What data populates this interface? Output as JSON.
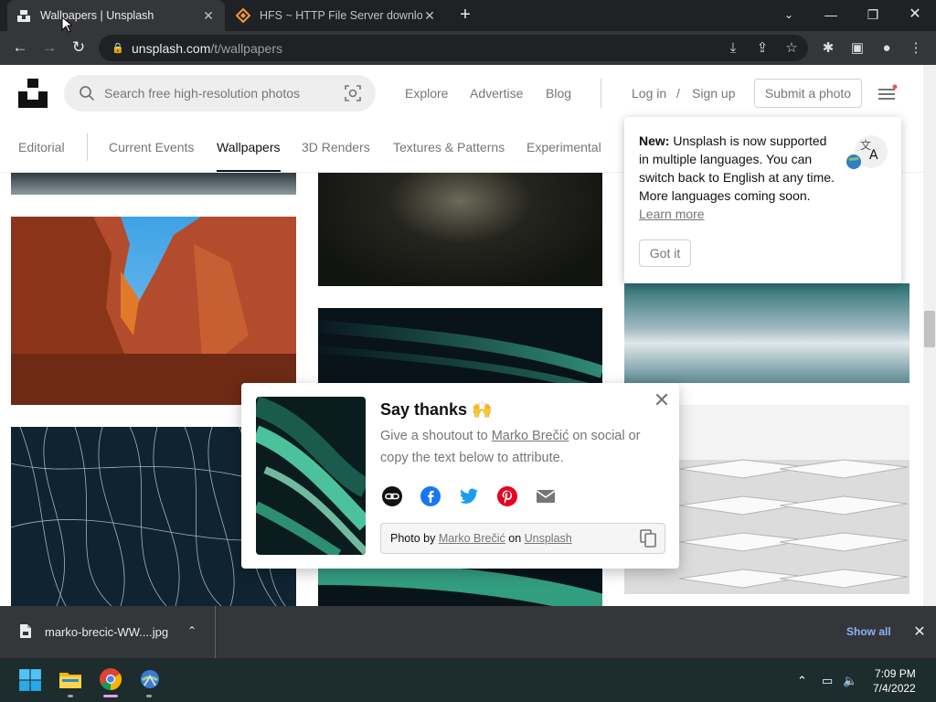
{
  "browser": {
    "tabs": [
      {
        "title": "Wallpapers | Unsplash",
        "active": true
      },
      {
        "title": "HFS ~ HTTP File Server download",
        "active": false
      }
    ],
    "url_host": "unsplash.com",
    "url_path": "/t/wallpapers"
  },
  "header": {
    "search_placeholder": "Search free high-resolution photos",
    "nav": [
      "Explore",
      "Advertise",
      "Blog"
    ],
    "login": "Log in",
    "slash": "/",
    "signup": "Sign up",
    "submit": "Submit a photo"
  },
  "topics": [
    "Editorial",
    "Current Events",
    "Wallpapers",
    "3D Renders",
    "Textures & Patterns",
    "Experimental"
  ],
  "lang_popup": {
    "bold": "New:",
    "text": " Unsplash is now supported in multiple languages. You can switch back to English at any time. More languages coming soon.",
    "link": "Learn more",
    "button": "Got it"
  },
  "say_thanks": {
    "title": "Say thanks 🙌",
    "body_pre": "Give a shoutout to ",
    "author": "Marko Brečić",
    "body_post": " on social or copy the text below to attribute.",
    "credit_pre": "Photo by ",
    "credit_author": "Marko Brečić",
    "credit_mid": " on ",
    "credit_site": "Unsplash"
  },
  "download": {
    "file": "marko-brecic-WW....jpg",
    "show_all": "Show all"
  },
  "taskbar": {
    "time": "7:09 PM",
    "date": "7/4/2022"
  },
  "colors": {
    "tabbar": "#202124",
    "toolbar": "#35363a",
    "taskbar": "#1d2c2c",
    "link_blue": "#8ab4f8"
  }
}
